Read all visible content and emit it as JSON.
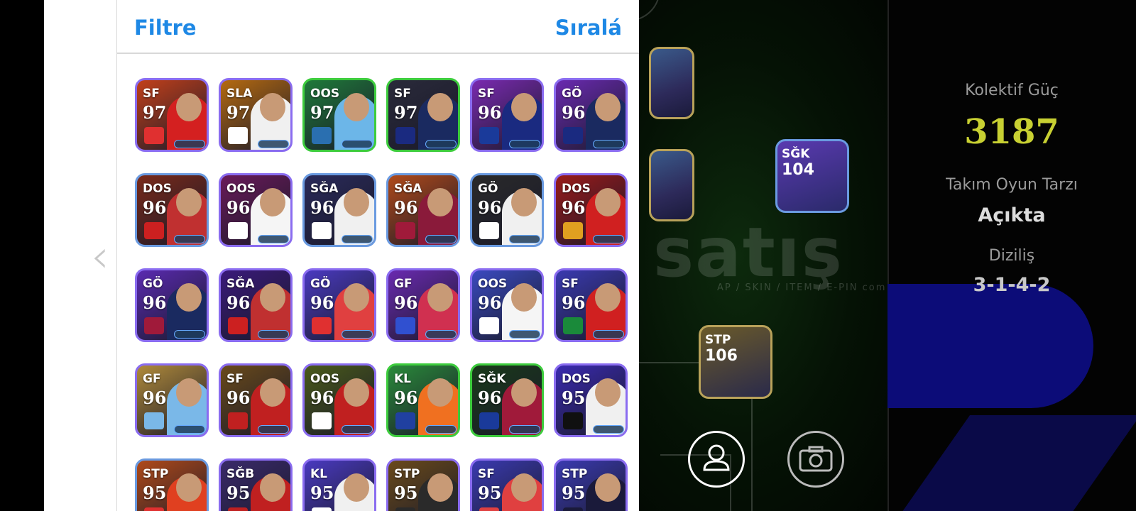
{
  "header": {
    "filter_label": "Filtre",
    "sort_label": "Sıralá"
  },
  "team_stats": {
    "collective_power_label": "Kolektif Güç",
    "collective_power_value": "3187",
    "play_style_label": "Takım Oyun Tarzı",
    "play_style_value": "Açıkta",
    "formation_label": "Diziliş",
    "formation_value": "3-1-4-2"
  },
  "watermark": {
    "text": "satış",
    "subtext": "AP / SKIN / ITEM / E-PIN   com"
  },
  "pitch_players": [
    {
      "position": "",
      "rating": ""
    },
    {
      "position": "",
      "rating": ""
    },
    {
      "position": "SĞK",
      "rating": "104"
    },
    {
      "position": "STP",
      "rating": "106"
    }
  ],
  "icons": {
    "back": "chevron-left-icon",
    "profile": "user-icon",
    "camera": "camera-icon"
  },
  "players": [
    {
      "position": "SF",
      "rating": "97",
      "border": "#8a6cf0",
      "bg": "#c2401a",
      "kit": "#d42020",
      "badge": "#e03030"
    },
    {
      "position": "SLA",
      "rating": "97",
      "border": "#8a6cf0",
      "bg": "#b56a10",
      "kit": "#f0f0f0",
      "badge": "#ffffff"
    },
    {
      "position": "OOS",
      "rating": "97",
      "border": "#3dcc3d",
      "bg": "#1f7a3a",
      "kit": "#6cb6e8",
      "badge": "#2a6fb0"
    },
    {
      "position": "SF",
      "rating": "97",
      "border": "#3dcc3d",
      "bg": "#2a2a3a",
      "kit": "#1a2a60",
      "badge": "#1a2a80"
    },
    {
      "position": "SF",
      "rating": "96",
      "border": "#8a6cf0",
      "bg": "#7a2ab0",
      "kit": "#1a2a80",
      "badge": "#1a3a9a"
    },
    {
      "position": "GÖ",
      "rating": "96",
      "border": "#8a6cf0",
      "bg": "#6a2ab0",
      "kit": "#1a2a60",
      "badge": "#1a2a80"
    },
    {
      "position": "DOS",
      "rating": "96",
      "border": "#6a9ae0",
      "bg": "#7a2a1a",
      "kit": "#c03030",
      "badge": "#cc2020"
    },
    {
      "position": "OOS",
      "rating": "96",
      "border": "#8a6cf0",
      "bg": "#6a1a5a",
      "kit": "#f5f5f5",
      "badge": "#ffffff"
    },
    {
      "position": "SĞA",
      "rating": "96",
      "border": "#6a9ae0",
      "bg": "#2a2a5a",
      "kit": "#f0f0f0",
      "badge": "#ffffff"
    },
    {
      "position": "SĞA",
      "rating": "96",
      "border": "#6a9ae0",
      "bg": "#b04a1a",
      "kit": "#8a1a3a",
      "badge": "#a01a3a"
    },
    {
      "position": "GÖ",
      "rating": "96",
      "border": "#6a9ae0",
      "bg": "#2a2a2a",
      "kit": "#f0f0f0",
      "badge": "#ffffff"
    },
    {
      "position": "DOS",
      "rating": "96",
      "border": "#8a6cf0",
      "bg": "#9a1a1a",
      "kit": "#d02020",
      "badge": "#e0a020"
    },
    {
      "position": "GÖ",
      "rating": "96",
      "border": "#8a6cf0",
      "bg": "#5a2ab0",
      "kit": "#1a2a60",
      "badge": "#a01a3a"
    },
    {
      "position": "SĞA",
      "rating": "96",
      "border": "#8a6cf0",
      "bg": "#3a1a7a",
      "kit": "#c03030",
      "badge": "#cc2020"
    },
    {
      "position": "GÖ",
      "rating": "96",
      "border": "#8a6cf0",
      "bg": "#4a3ac0",
      "kit": "#e04040",
      "badge": "#e03030"
    },
    {
      "position": "GF",
      "rating": "96",
      "border": "#8a6cf0",
      "bg": "#6a2ab0",
      "kit": "#d03050",
      "badge": "#3050d0"
    },
    {
      "position": "OOS",
      "rating": "96",
      "border": "#8a6cf0",
      "bg": "#3a4ac0",
      "kit": "#f5f5f5",
      "badge": "#ffffff"
    },
    {
      "position": "SF",
      "rating": "96",
      "border": "#8a6cf0",
      "bg": "#3a3ab0",
      "kit": "#d02020",
      "badge": "#1a8a3a"
    },
    {
      "position": "GF",
      "rating": "96",
      "border": "#8a6cf0",
      "bg": "#b08a3a",
      "kit": "#7ab8e8",
      "badge": "#7ab8e8"
    },
    {
      "position": "SF",
      "rating": "96",
      "border": "#8a6cf0",
      "bg": "#6a4a1a",
      "kit": "#c02020",
      "badge": "#c02020"
    },
    {
      "position": "OOS",
      "rating": "96",
      "border": "#8a6cf0",
      "bg": "#4a5a1a",
      "kit": "#c02020",
      "badge": "#ffffff"
    },
    {
      "position": "KL",
      "rating": "96",
      "border": "#3dcc3d",
      "bg": "#2a8a3a",
      "kit": "#f07020",
      "badge": "#2040a0"
    },
    {
      "position": "SĞK",
      "rating": "96",
      "border": "#3dcc3d",
      "bg": "#1a3a1a",
      "kit": "#a01a3a",
      "badge": "#1a3a9a"
    },
    {
      "position": "DOS",
      "rating": "95",
      "border": "#8a6cf0",
      "bg": "#3a2ab0",
      "kit": "#f0f0f0",
      "badge": "#101010"
    },
    {
      "position": "STP",
      "rating": "95",
      "border": "#6a9ae0",
      "bg": "#b04a1a",
      "kit": "#e04020",
      "badge": "#e03030"
    },
    {
      "position": "SĞB",
      "rating": "95",
      "border": "#8a6cf0",
      "bg": "#3a2a6a",
      "kit": "#c02020",
      "badge": "#c02020"
    },
    {
      "position": "KL",
      "rating": "95",
      "border": "#8a6cf0",
      "bg": "#4a3ac0",
      "kit": "#f0f0f0",
      "badge": "#ffffff"
    },
    {
      "position": "STP",
      "rating": "95",
      "border": "#8a6cf0",
      "bg": "#6a4a1a",
      "kit": "#2a2a2a",
      "badge": "#2a2a2a"
    },
    {
      "position": "SF",
      "rating": "95",
      "border": "#8a6cf0",
      "bg": "#3a3ab0",
      "kit": "#e04040",
      "badge": "#e04040"
    },
    {
      "position": "STP",
      "rating": "95",
      "border": "#8a6cf0",
      "bg": "#3a3ab0",
      "kit": "#1a1a3a",
      "badge": "#1a1a3a"
    }
  ]
}
